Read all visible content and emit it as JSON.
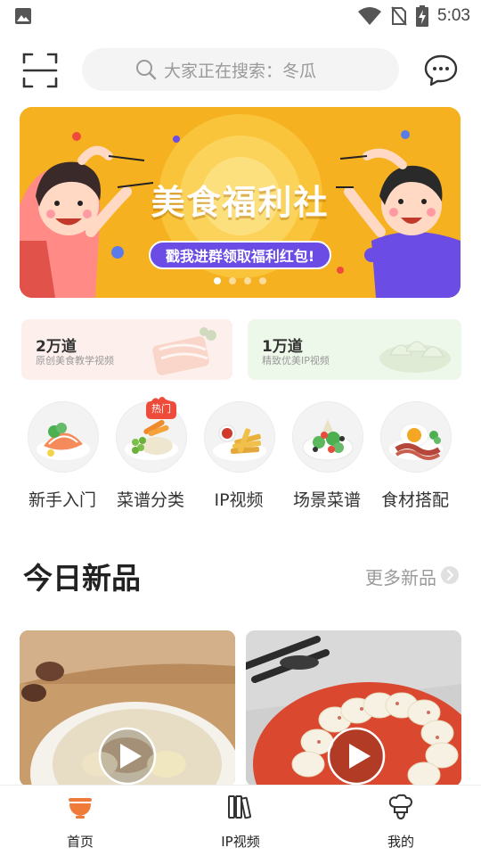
{
  "status_bar": {
    "time": "5:03",
    "icons": [
      "image-icon",
      "wifi-icon",
      "no-sim-icon",
      "battery-charging-icon"
    ]
  },
  "search": {
    "placeholder": "大家正在搜索：冬瓜"
  },
  "banner": {
    "title": "美食福利社",
    "cta": "戳我进群领取福利红包!",
    "slide_count": 4,
    "active_slide": 1
  },
  "promos": [
    {
      "title": "2万道",
      "subtitle": "原创美食教学视频"
    },
    {
      "title": "1万道",
      "subtitle": "精致优美IP视频"
    }
  ],
  "categories": [
    {
      "label": "新手入门",
      "icon": "salmon-dish-icon"
    },
    {
      "label": "菜谱分类",
      "icon": "vegetable-rice-icon",
      "badge": "热门"
    },
    {
      "label": "IP视频",
      "icon": "fries-icon"
    },
    {
      "label": "场景菜谱",
      "icon": "salad-icon"
    },
    {
      "label": "食材搭配",
      "icon": "fried-egg-icon"
    }
  ],
  "section": {
    "title": "今日新品",
    "more": "更多新品"
  },
  "cards": [
    {
      "icon": "play-icon",
      "subject": "soup"
    },
    {
      "icon": "play-icon",
      "subject": "sliced-yam"
    }
  ],
  "bottom_nav": [
    {
      "label": "首页",
      "icon": "bowl-icon",
      "active": true
    },
    {
      "label": "IP视频",
      "icon": "books-icon",
      "active": false
    },
    {
      "label": "我的",
      "icon": "chef-hat-icon",
      "active": false
    }
  ],
  "colors": {
    "accent": "#f07a3a",
    "banner_bg": "#f5b11f",
    "pill": "#6b4de6",
    "hot": "#ee4b3a"
  }
}
